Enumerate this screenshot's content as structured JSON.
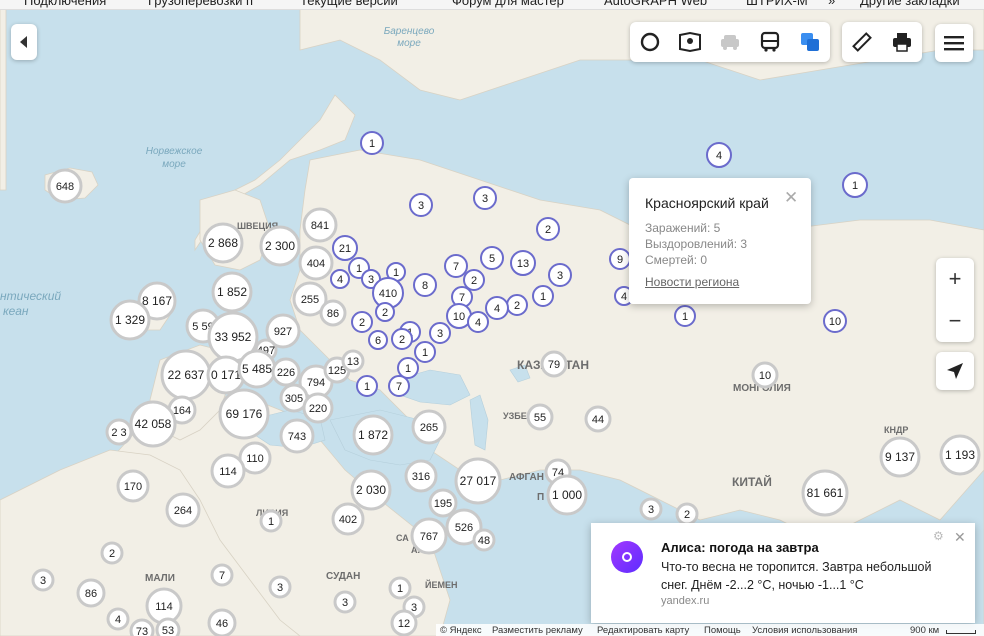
{
  "bookmarks": [
    "Подключения",
    "Грузоперевозки п",
    "Текущие версии",
    "Форум для мастер",
    "AutoGRAPH Web",
    "ШТРИХ-М",
    "»",
    "Другие закладки"
  ],
  "seas": [
    {
      "id": "barents",
      "lines": [
        "Баренцево",
        "море"
      ]
    },
    {
      "id": "norwegian",
      "lines": [
        "Норвежское",
        "море"
      ]
    },
    {
      "id": "atlantic",
      "lines": [
        "нтический",
        "кеан"
      ]
    }
  ],
  "countries": [
    "ШВЕЦИЯ",
    "КАЗАХСТАН",
    "УЗБЕ",
    "АФГАН",
    "П",
    "МОНГОЛИЯ",
    "КИТАЙ",
    "КНДР",
    "ЛИВИЯ",
    "СУДАН",
    "МАЛИ",
    "ЙЕМЕН",
    "СА",
    "АЯ"
  ],
  "clusters": [
    {
      "label": "648",
      "kind": "grey"
    },
    {
      "label": "841",
      "kind": "grey"
    },
    {
      "label": "2 868",
      "kind": "grey"
    },
    {
      "label": "2 300",
      "kind": "grey"
    },
    {
      "label": "404",
      "kind": "grey"
    },
    {
      "label": "8 167",
      "kind": "grey"
    },
    {
      "label": "1 852",
      "kind": "grey"
    },
    {
      "label": "255",
      "kind": "grey"
    },
    {
      "label": "1 329",
      "kind": "grey"
    },
    {
      "label": "5 59",
      "kind": "grey"
    },
    {
      "label": "33 952",
      "kind": "grey"
    },
    {
      "label": "927",
      "kind": "grey"
    },
    {
      "label": "86",
      "kind": "grey"
    },
    {
      "label": "497",
      "kind": "grey"
    },
    {
      "label": "22 637",
      "kind": "grey"
    },
    {
      "label": "0 171",
      "kind": "grey"
    },
    {
      "label": "5 485",
      "kind": "grey"
    },
    {
      "label": "226",
      "kind": "grey"
    },
    {
      "label": "794",
      "kind": "grey"
    },
    {
      "label": "125",
      "kind": "grey"
    },
    {
      "label": "13",
      "kind": "grey"
    },
    {
      "label": "164",
      "kind": "grey"
    },
    {
      "label": "69 176",
      "kind": "grey"
    },
    {
      "label": "305",
      "kind": "grey"
    },
    {
      "label": "220",
      "kind": "grey"
    },
    {
      "label": "42 058",
      "kind": "grey"
    },
    {
      "label": "2 3",
      "kind": "grey"
    },
    {
      "label": "743",
      "kind": "grey"
    },
    {
      "label": "1 872",
      "kind": "grey"
    },
    {
      "label": "265",
      "kind": "grey"
    },
    {
      "label": "110",
      "kind": "grey"
    },
    {
      "label": "114",
      "kind": "grey"
    },
    {
      "label": "316",
      "kind": "grey"
    },
    {
      "label": "27 017",
      "kind": "grey"
    },
    {
      "label": "2 030",
      "kind": "grey"
    },
    {
      "label": "170",
      "kind": "grey"
    },
    {
      "label": "264",
      "kind": "grey"
    },
    {
      "label": "402",
      "kind": "grey"
    },
    {
      "label": "195",
      "kind": "grey"
    },
    {
      "label": "526",
      "kind": "grey"
    },
    {
      "label": "767",
      "kind": "grey"
    },
    {
      "label": "48",
      "kind": "grey"
    },
    {
      "label": "79",
      "kind": "grey"
    },
    {
      "label": "55",
      "kind": "grey"
    },
    {
      "label": "44",
      "kind": "grey"
    },
    {
      "label": "74",
      "kind": "grey"
    },
    {
      "label": "1 000",
      "kind": "grey"
    },
    {
      "label": "10",
      "kind": "grey"
    },
    {
      "label": "81 661",
      "kind": "grey"
    },
    {
      "label": "9 137",
      "kind": "grey"
    },
    {
      "label": "1 193",
      "kind": "grey"
    },
    {
      "label": "3",
      "kind": "grey"
    },
    {
      "label": "2",
      "kind": "grey"
    },
    {
      "label": "1",
      "kind": "grey"
    },
    {
      "label": "2",
      "kind": "grey"
    },
    {
      "label": "7",
      "kind": "grey"
    },
    {
      "label": "3",
      "kind": "grey"
    },
    {
      "label": "3",
      "kind": "grey"
    },
    {
      "label": "86",
      "kind": "grey"
    },
    {
      "label": "114",
      "kind": "grey"
    },
    {
      "label": "4",
      "kind": "grey"
    },
    {
      "label": "73",
      "kind": "grey"
    },
    {
      "label": "53",
      "kind": "grey"
    },
    {
      "label": "46",
      "kind": "grey"
    },
    {
      "label": "3",
      "kind": "grey"
    },
    {
      "label": "1",
      "kind": "grey"
    },
    {
      "label": "3",
      "kind": "grey"
    },
    {
      "label": "12",
      "kind": "grey"
    },
    {
      "label": "1",
      "kind": "blue"
    },
    {
      "label": "3",
      "kind": "blue"
    },
    {
      "label": "3",
      "kind": "blue"
    },
    {
      "label": "2",
      "kind": "blue"
    },
    {
      "label": "21",
      "kind": "blue"
    },
    {
      "label": "1",
      "kind": "blue"
    },
    {
      "label": "4",
      "kind": "blue"
    },
    {
      "label": "3",
      "kind": "blue"
    },
    {
      "label": "1",
      "kind": "blue"
    },
    {
      "label": "410",
      "kind": "blue"
    },
    {
      "label": "8",
      "kind": "blue"
    },
    {
      "label": "7",
      "kind": "blue"
    },
    {
      "label": "5",
      "kind": "blue"
    },
    {
      "label": "13",
      "kind": "blue"
    },
    {
      "label": "2",
      "kind": "blue"
    },
    {
      "label": "3",
      "kind": "blue"
    },
    {
      "label": "1",
      "kind": "blue"
    },
    {
      "label": "2",
      "kind": "blue"
    },
    {
      "label": "7",
      "kind": "blue"
    },
    {
      "label": "10",
      "kind": "blue"
    },
    {
      "label": "4",
      "kind": "blue"
    },
    {
      "label": "4",
      "kind": "blue"
    },
    {
      "label": "2",
      "kind": "blue"
    },
    {
      "label": "1",
      "kind": "blue"
    },
    {
      "label": "2",
      "kind": "blue"
    },
    {
      "label": "2",
      "kind": "blue"
    },
    {
      "label": "6",
      "kind": "blue"
    },
    {
      "label": "3",
      "kind": "blue"
    },
    {
      "label": "1",
      "kind": "blue"
    },
    {
      "label": "1",
      "kind": "blue"
    },
    {
      "label": "1",
      "kind": "blue"
    },
    {
      "label": "7",
      "kind": "blue"
    },
    {
      "label": "9",
      "kind": "blue"
    },
    {
      "label": "4",
      "kind": "blue"
    },
    {
      "label": "1",
      "kind": "blue"
    },
    {
      "label": "10",
      "kind": "blue"
    },
    {
      "label": "1",
      "kind": "blue"
    },
    {
      "label": "4",
      "kind": "blue"
    },
    {
      "label": "1",
      "kind": "blue"
    },
    {
      "label": "1",
      "kind": "blue"
    },
    {
      "label": "1",
      "kind": "blue"
    },
    {
      "label": "5",
      "kind": "selected"
    }
  ],
  "popup": {
    "title": "Красноярский край",
    "infected": "Заражений: 5",
    "recovered": "Выздоровлений: 3",
    "deaths": "Смертей: 0",
    "link": "Новости региона"
  },
  "alice": {
    "title": "Алиса: погода на завтра",
    "text": "Что-то весна не торопится. Завтра небольшой снег. Днём -2...2 °С, ночью -1...1 °С",
    "source": "yandex.ru"
  },
  "footer": {
    "copyright": "© Яндекс",
    "ad": "Разместить рекламу",
    "edit": "Редактировать карту",
    "help": "Помощь",
    "terms": "Условия использования",
    "scale": "900 км"
  },
  "controls": {
    "zoom_in": "+",
    "zoom_out": "−"
  },
  "colors": {
    "land": "#f2efe6",
    "water": "#c7e0ec",
    "cluster_blue": "#6b6bcc",
    "selected": "#6b6bcc"
  }
}
